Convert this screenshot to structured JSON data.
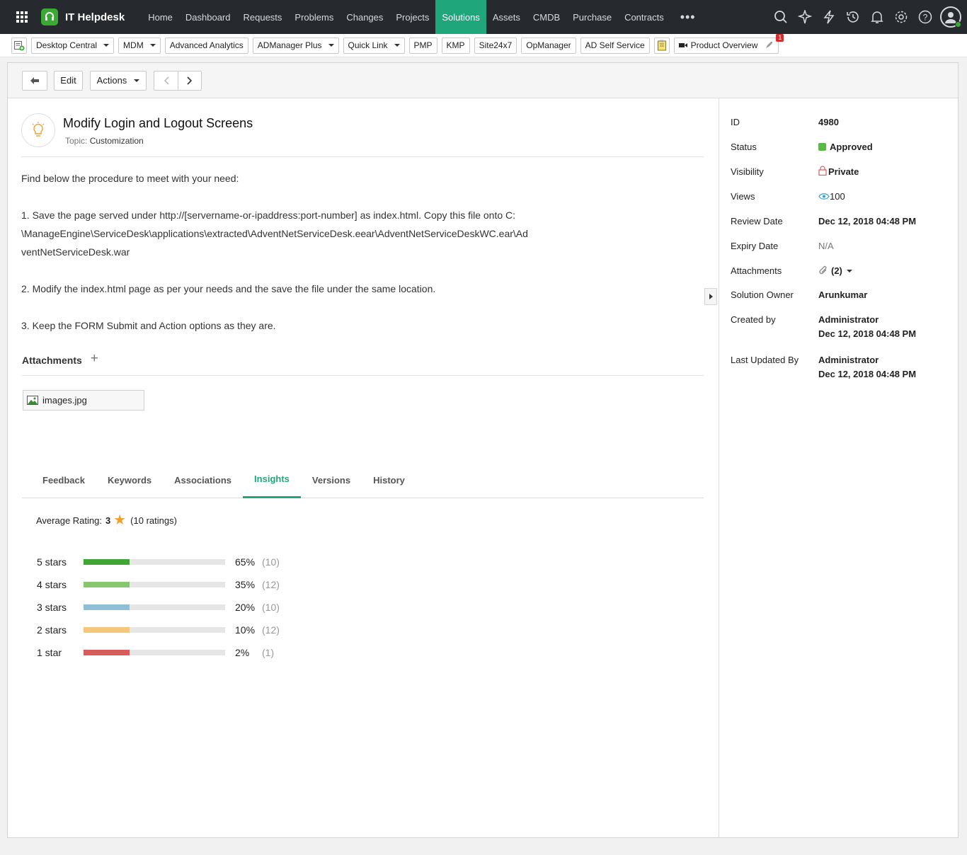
{
  "app": {
    "title": "IT Helpdesk",
    "nav": [
      "Home",
      "Dashboard",
      "Requests",
      "Problems",
      "Changes",
      "Projects",
      "Solutions",
      "Assets",
      "CMDB",
      "Purchase",
      "Contracts"
    ],
    "active_nav": "Solutions",
    "more_label": "•••"
  },
  "quick_links": {
    "items": [
      "Desktop Central",
      "MDM",
      "Advanced Analytics",
      "ADManager Plus",
      "Quick Link",
      "PMP",
      "KMP",
      "Site24x7",
      "OpManager",
      "AD Self Service"
    ],
    "product_overview": "Product Overview",
    "notification_count": "1"
  },
  "toolbar": {
    "edit_label": "Edit",
    "actions_label": "Actions"
  },
  "solution": {
    "title": "Modify Login and Logout Screens",
    "topic_label": "Topic:",
    "topic_value": "Customization",
    "body": [
      "Find below the procedure to meet with your need:",
      "",
      "1. Save the page served under http://[servername-or-ipaddress:port-number] as index.html. Copy this file onto C:",
      "\\ManageEngine\\ServiceDesk\\applications\\extracted\\AdventNetServiceDesk.eear\\AdventNetServiceDeskWC.ear\\Ad",
      "ventNetServiceDesk.war",
      "",
      "2. Modify the index.html page as per your needs and the save the file under the same location.",
      "",
      "3. Keep the FORM Submit and Action options as they are."
    ]
  },
  "attachments": {
    "label": "Attachments",
    "add": "+",
    "file": "images.jpg"
  },
  "tabs": [
    "Feedback",
    "Keywords",
    "Associations",
    "Insights",
    "Versions",
    "History"
  ],
  "active_tab": "Insights",
  "insights": {
    "avg_label": "Average Rating:",
    "avg_value": "3",
    "ratings_text": "(10 ratings)",
    "rows": [
      {
        "label": "5 stars",
        "percent": 65,
        "percent_text": "65%",
        "count_text": "(10)",
        "color": "#3fa535"
      },
      {
        "label": "4  stars",
        "percent": 35,
        "percent_text": "35%",
        "count_text": "(12)",
        "color": "#86c66f"
      },
      {
        "label": "3  stars",
        "percent": 20,
        "percent_text": "20%",
        "count_text": "(10)",
        "color": "#8fbfd4"
      },
      {
        "label": "2  stars",
        "percent": 10,
        "percent_text": "10%",
        "count_text": "(12)",
        "color": "#f5c77d"
      },
      {
        "label": "1 star",
        "percent": 2,
        "percent_text": "2%",
        "count_text": "(1)",
        "color": "#d95c5c"
      }
    ]
  },
  "properties": {
    "id_label": "ID",
    "id_value": "4980",
    "status_label": "Status",
    "status_value": "Approved",
    "visibility_label": "Visibility",
    "visibility_value": "Private",
    "views_label": "Views",
    "views_value": "100",
    "review_label": "Review Date",
    "review_value": "Dec 12, 2018 04:48 PM",
    "expiry_label": "Expiry Date",
    "expiry_value": "N/A",
    "attachments_label": "Attachments",
    "attachments_value": "(2)",
    "owner_label": "Solution Owner",
    "owner_value": "Arunkumar",
    "created_label": "Created by",
    "created_by": "Administrator",
    "created_date": "Dec 12, 2018 04:48 PM",
    "updated_label": "Last Updated By",
    "updated_by": "Administrator",
    "updated_date": "Dec 12, 2018 04:48 PM"
  },
  "colors": {
    "accent": "#1fa67a",
    "navbar": "#26292e",
    "status_approved": "#5cb84a"
  }
}
